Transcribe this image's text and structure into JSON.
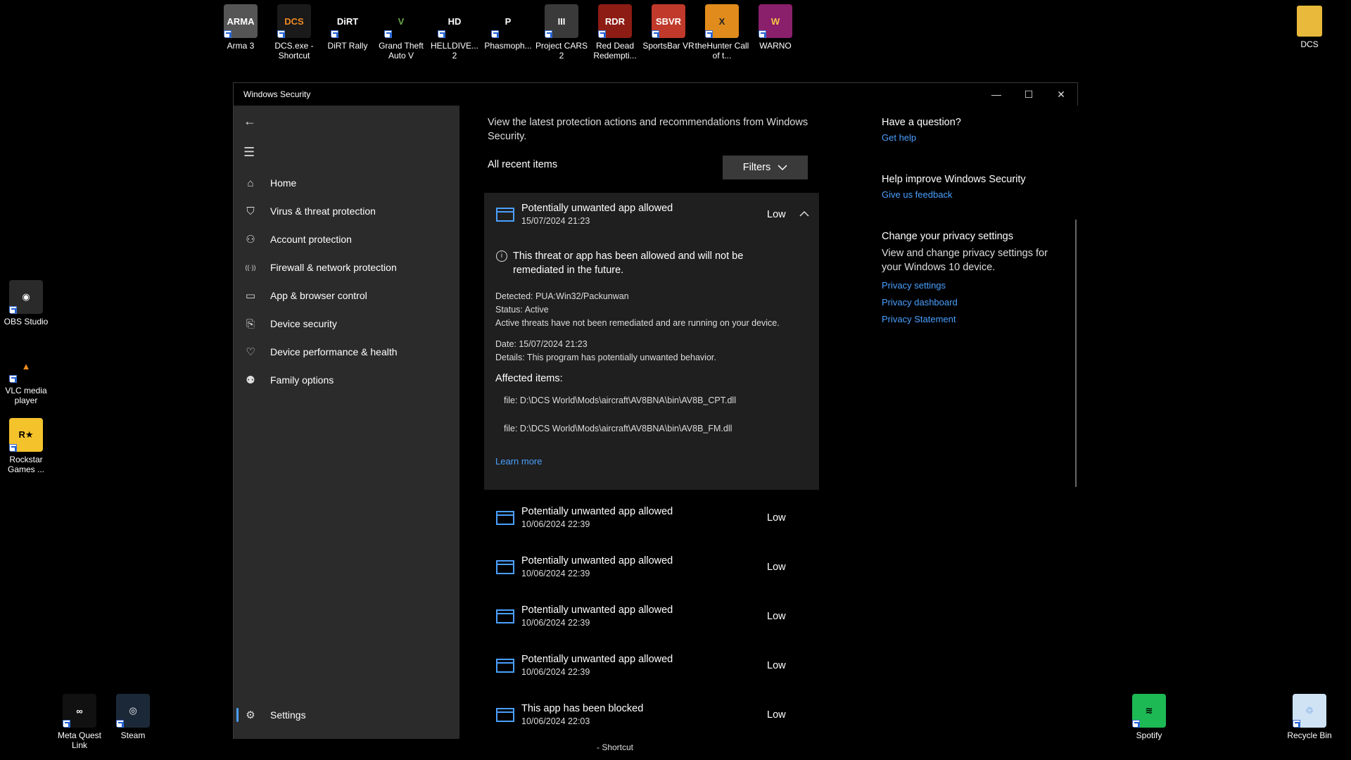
{
  "desktop": {
    "icons_top": [
      {
        "label": "Arma 3",
        "icon": "arma3-icon",
        "bg": "#555",
        "glyph": "ARMA",
        "color": "#fff"
      },
      {
        "label": "DCS.exe - Shortcut",
        "icon": "dcs-icon",
        "bg": "#1a1a1a",
        "glyph": "DCS",
        "color": "#f08a24"
      },
      {
        "label": "DiRT Rally",
        "icon": "dirt-rally-icon",
        "bg": "#000",
        "glyph": "DiRT",
        "color": "#fff"
      },
      {
        "label": "Grand Theft Auto V",
        "icon": "gta5-icon",
        "bg": "#000",
        "glyph": "V",
        "color": "#6ea94a"
      },
      {
        "label": "HELLDIVE... 2",
        "icon": "helldivers2-icon",
        "bg": "#000",
        "glyph": "HD",
        "color": "#fff"
      },
      {
        "label": "Phasmoph...",
        "icon": "phasmophobia-icon",
        "bg": "#000",
        "glyph": "P",
        "color": "#fff"
      },
      {
        "label": "Project CARS 2",
        "icon": "project-cars-icon",
        "bg": "#3a3a3a",
        "glyph": "III",
        "color": "#fff"
      },
      {
        "label": "Red Dead Redempti...",
        "icon": "red-dead-icon",
        "bg": "#8c1c14",
        "glyph": "RDR",
        "color": "#fff"
      },
      {
        "label": "SportsBar VR",
        "icon": "sportsbar-vr-icon",
        "bg": "#c0392b",
        "glyph": "SBVR",
        "color": "#fff"
      },
      {
        "label": "theHunter Call of t...",
        "icon": "thehunter-icon",
        "bg": "#e08b1c",
        "glyph": "X",
        "color": "#222"
      },
      {
        "label": "WARNO",
        "icon": "warno-icon",
        "bg": "#8a1f6b",
        "glyph": "W",
        "color": "#f6c945"
      }
    ],
    "icon_dcs_folder": {
      "label": "DCS",
      "icon": "folder-icon",
      "bg": "#e8b93a"
    },
    "icons_left": [
      {
        "label": "OBS Studio",
        "icon": "obs-icon",
        "bg": "#2a2a2a",
        "glyph": "◉",
        "color": "#fff"
      },
      {
        "label": "VLC media player",
        "icon": "vlc-icon",
        "bg": "#000",
        "glyph": "▲",
        "color": "#f28c1c"
      },
      {
        "label": "Rockstar Games ...",
        "icon": "rockstar-icon",
        "bg": "#f4c22b",
        "glyph": "R★",
        "color": "#000"
      }
    ],
    "icons_bottom": [
      {
        "label": "Meta Quest Link",
        "icon": "meta-quest-icon",
        "bg": "#111",
        "glyph": "∞",
        "color": "#fff"
      },
      {
        "label": "Steam",
        "icon": "steam-icon",
        "bg": "#1b2838",
        "glyph": "◎",
        "color": "#fff"
      },
      {
        "label": "Spotify",
        "icon": "spotify-icon",
        "bg": "#1db954",
        "glyph": "≋",
        "color": "#000"
      },
      {
        "label": "Recycle Bin",
        "icon": "recycle-bin-icon",
        "bg": "#cfe3f5",
        "glyph": "♲",
        "color": "#3a7bd5"
      }
    ],
    "taskbar_hint": "- Shortcut"
  },
  "window": {
    "title": "Windows Security",
    "minimize": "—",
    "maximize": "☐",
    "close": "✕"
  },
  "sidebar": {
    "back": "←",
    "menu": "☰",
    "items": [
      {
        "label": "Home",
        "icon": "⌂"
      },
      {
        "label": "Virus & threat protection",
        "icon": "⛉"
      },
      {
        "label": "Account protection",
        "icon": "⚇"
      },
      {
        "label": "Firewall & network protection",
        "icon": "((·))"
      },
      {
        "label": "App & browser control",
        "icon": "▭"
      },
      {
        "label": "Device security",
        "icon": "⎘"
      },
      {
        "label": "Device performance & health",
        "icon": "♡"
      },
      {
        "label": "Family options",
        "icon": "⚉"
      }
    ],
    "settings": {
      "label": "Settings",
      "icon": "⚙"
    }
  },
  "main": {
    "intro": "View the latest protection actions and recommendations from Windows Security.",
    "recent_title": "All recent items",
    "filters_label": "Filters",
    "expanded": {
      "title": "Potentially unwanted app allowed",
      "date": "15/07/2024 21:23",
      "severity": "Low",
      "info": "This threat or app has been allowed and will not be remediated in the future.",
      "detected": "Detected:  PUA:Win32/Packunwan",
      "status": "Status:  Active",
      "status_note": "Active threats have not been remediated and are running on your device.",
      "date_line": "Date:  15/07/2024 21:23",
      "details": "Details:  This program has potentially unwanted behavior.",
      "affected_title": "Affected items:",
      "files": [
        "file: D:\\DCS World\\Mods\\aircraft\\AV8BNA\\bin\\AV8B_CPT.dll",
        "file: D:\\DCS World\\Mods\\aircraft\\AV8BNA\\bin\\AV8B_FM.dll"
      ],
      "learn_more": "Learn more"
    },
    "items": [
      {
        "title": "Potentially unwanted app allowed",
        "date": "10/06/2024 22:39",
        "severity": "Low"
      },
      {
        "title": "Potentially unwanted app allowed",
        "date": "10/06/2024 22:39",
        "severity": "Low"
      },
      {
        "title": "Potentially unwanted app allowed",
        "date": "10/06/2024 22:39",
        "severity": "Low"
      },
      {
        "title": "Potentially unwanted app allowed",
        "date": "10/06/2024 22:39",
        "severity": "Low"
      },
      {
        "title": "This app has been blocked",
        "date": "10/06/2024 22:03",
        "severity": "Low"
      }
    ]
  },
  "right_pane": {
    "question_head": "Have a question?",
    "get_help": "Get help",
    "improve_head": "Help improve Windows Security",
    "feedback": "Give us feedback",
    "privacy_head": "Change your privacy settings",
    "privacy_text": "View and change privacy settings for your Windows 10 device.",
    "privacy_settings": "Privacy settings",
    "privacy_dashboard": "Privacy dashboard",
    "privacy_statement": "Privacy Statement"
  },
  "colors": {
    "accent": "#4aa0ff",
    "sidebar_bg": "#2b2b2b",
    "card_bg": "#1f1f1f"
  }
}
